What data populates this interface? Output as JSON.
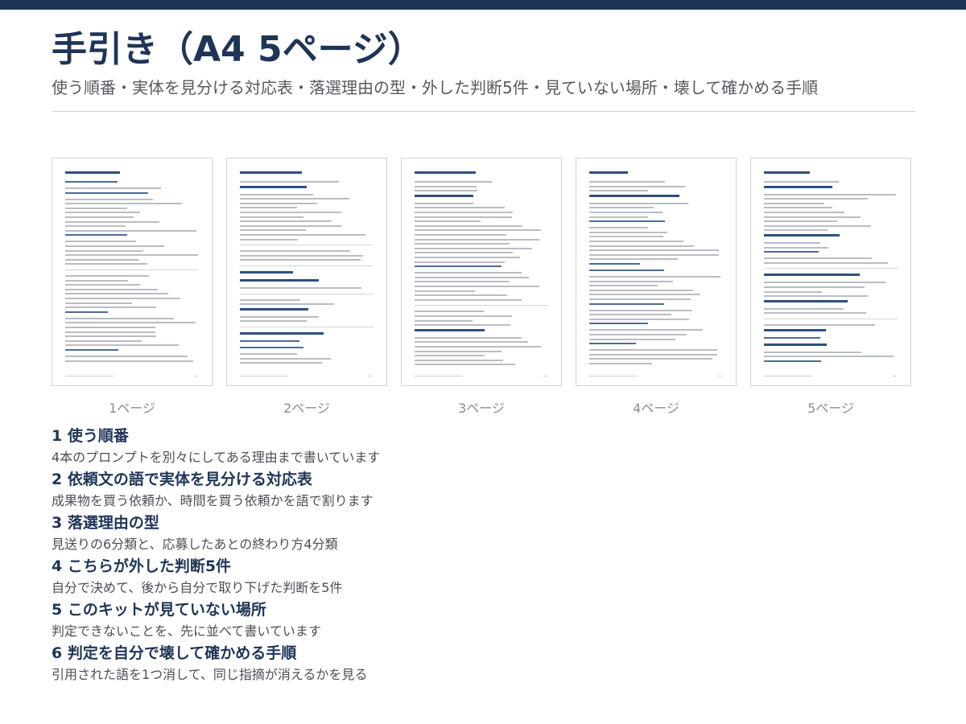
{
  "header": {
    "title": "手引き（A4 5ページ）",
    "subtitle": "使う順番・実体を見分ける対応表・落選理由の型・外した判断5件・見ていない場所・壊して確かめる手順",
    "accent_color": "#1f3557"
  },
  "pages": [
    {
      "label": "1ページ"
    },
    {
      "label": "2ページ"
    },
    {
      "label": "3ページ"
    },
    {
      "label": "4ページ"
    },
    {
      "label": "5ページ"
    }
  ],
  "sections": [
    {
      "heading": "1 使う順番",
      "description": "4本のプロンプトを別々にしてある理由まで書いています"
    },
    {
      "heading": "2 依頼文の語で実体を見分ける対応表",
      "description": "成果物を買う依頼か、時間を買う依頼かを語で割ります"
    },
    {
      "heading": "3 落選理由の型",
      "description": "見送りの6分類と、応募したあとの終わり方4分類"
    },
    {
      "heading": "4 こちらが外した判断5件",
      "description": "自分で決めて、後から自分で取り下げた判断を5件"
    },
    {
      "heading": "5 このキットが見ていない場所",
      "description": "判定できないことを、先に並べて書いています"
    },
    {
      "heading": "6 判定を自分で壊して確かめる手順",
      "description": "引用された語を1つ消して、同じ指摘が消えるかを見る"
    }
  ]
}
